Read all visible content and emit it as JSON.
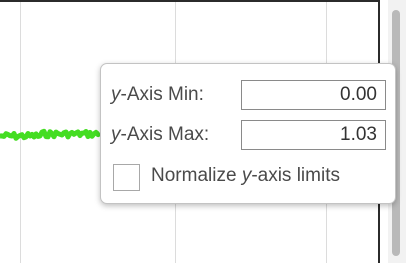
{
  "popup": {
    "y_min": {
      "label_italic": "y",
      "label_rest": "-Axis Min:",
      "value": "0.00"
    },
    "y_max": {
      "label_italic": "y",
      "label_rest": "-Axis Max:",
      "value": "1.03"
    },
    "normalize": {
      "label_pre": "Normalize ",
      "label_italic": "y",
      "label_post": "-axis limits",
      "checked": false
    }
  },
  "colors": {
    "signal": "#44dd22",
    "axes_border": "#2b2b2b",
    "gridline": "#dcdcdc"
  }
}
